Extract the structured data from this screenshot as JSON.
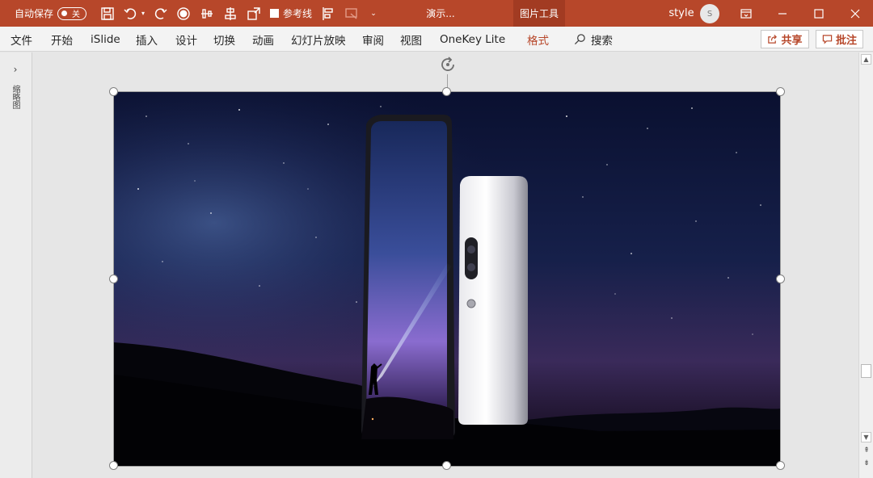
{
  "titlebar": {
    "autosave_label": "自动保存",
    "autosave_state": "关",
    "reference_lines_label": "参考线",
    "doc_title": "演示...",
    "context_tab": "图片工具",
    "user_name": "style",
    "user_initial": "S",
    "accent_color": "#b7472a",
    "quick_access_icons": [
      "save-icon",
      "undo-icon",
      "redo-icon",
      "record-icon",
      "distribute-icon",
      "align-icon",
      "shape-icon",
      "align-left-icon",
      "slide-shape-icon",
      "customize-icon"
    ],
    "window_controls": [
      "ribbon-display-icon",
      "minimize-icon",
      "maximize-icon",
      "close-icon"
    ]
  },
  "ribbon": {
    "tabs": [
      {
        "label": "文件"
      },
      {
        "label": "开始"
      },
      {
        "label": "iSlide"
      },
      {
        "label": "插入"
      },
      {
        "label": "设计"
      },
      {
        "label": "切换"
      },
      {
        "label": "动画"
      },
      {
        "label": "幻灯片放映"
      },
      {
        "label": "审阅"
      },
      {
        "label": "视图"
      },
      {
        "label": "OneKey Lite"
      },
      {
        "label": "格式",
        "active": true
      }
    ],
    "search_label": "搜索",
    "share_label": "共享",
    "comment_label": "批注"
  },
  "thumbnail_pane": {
    "label": "缩略图"
  }
}
